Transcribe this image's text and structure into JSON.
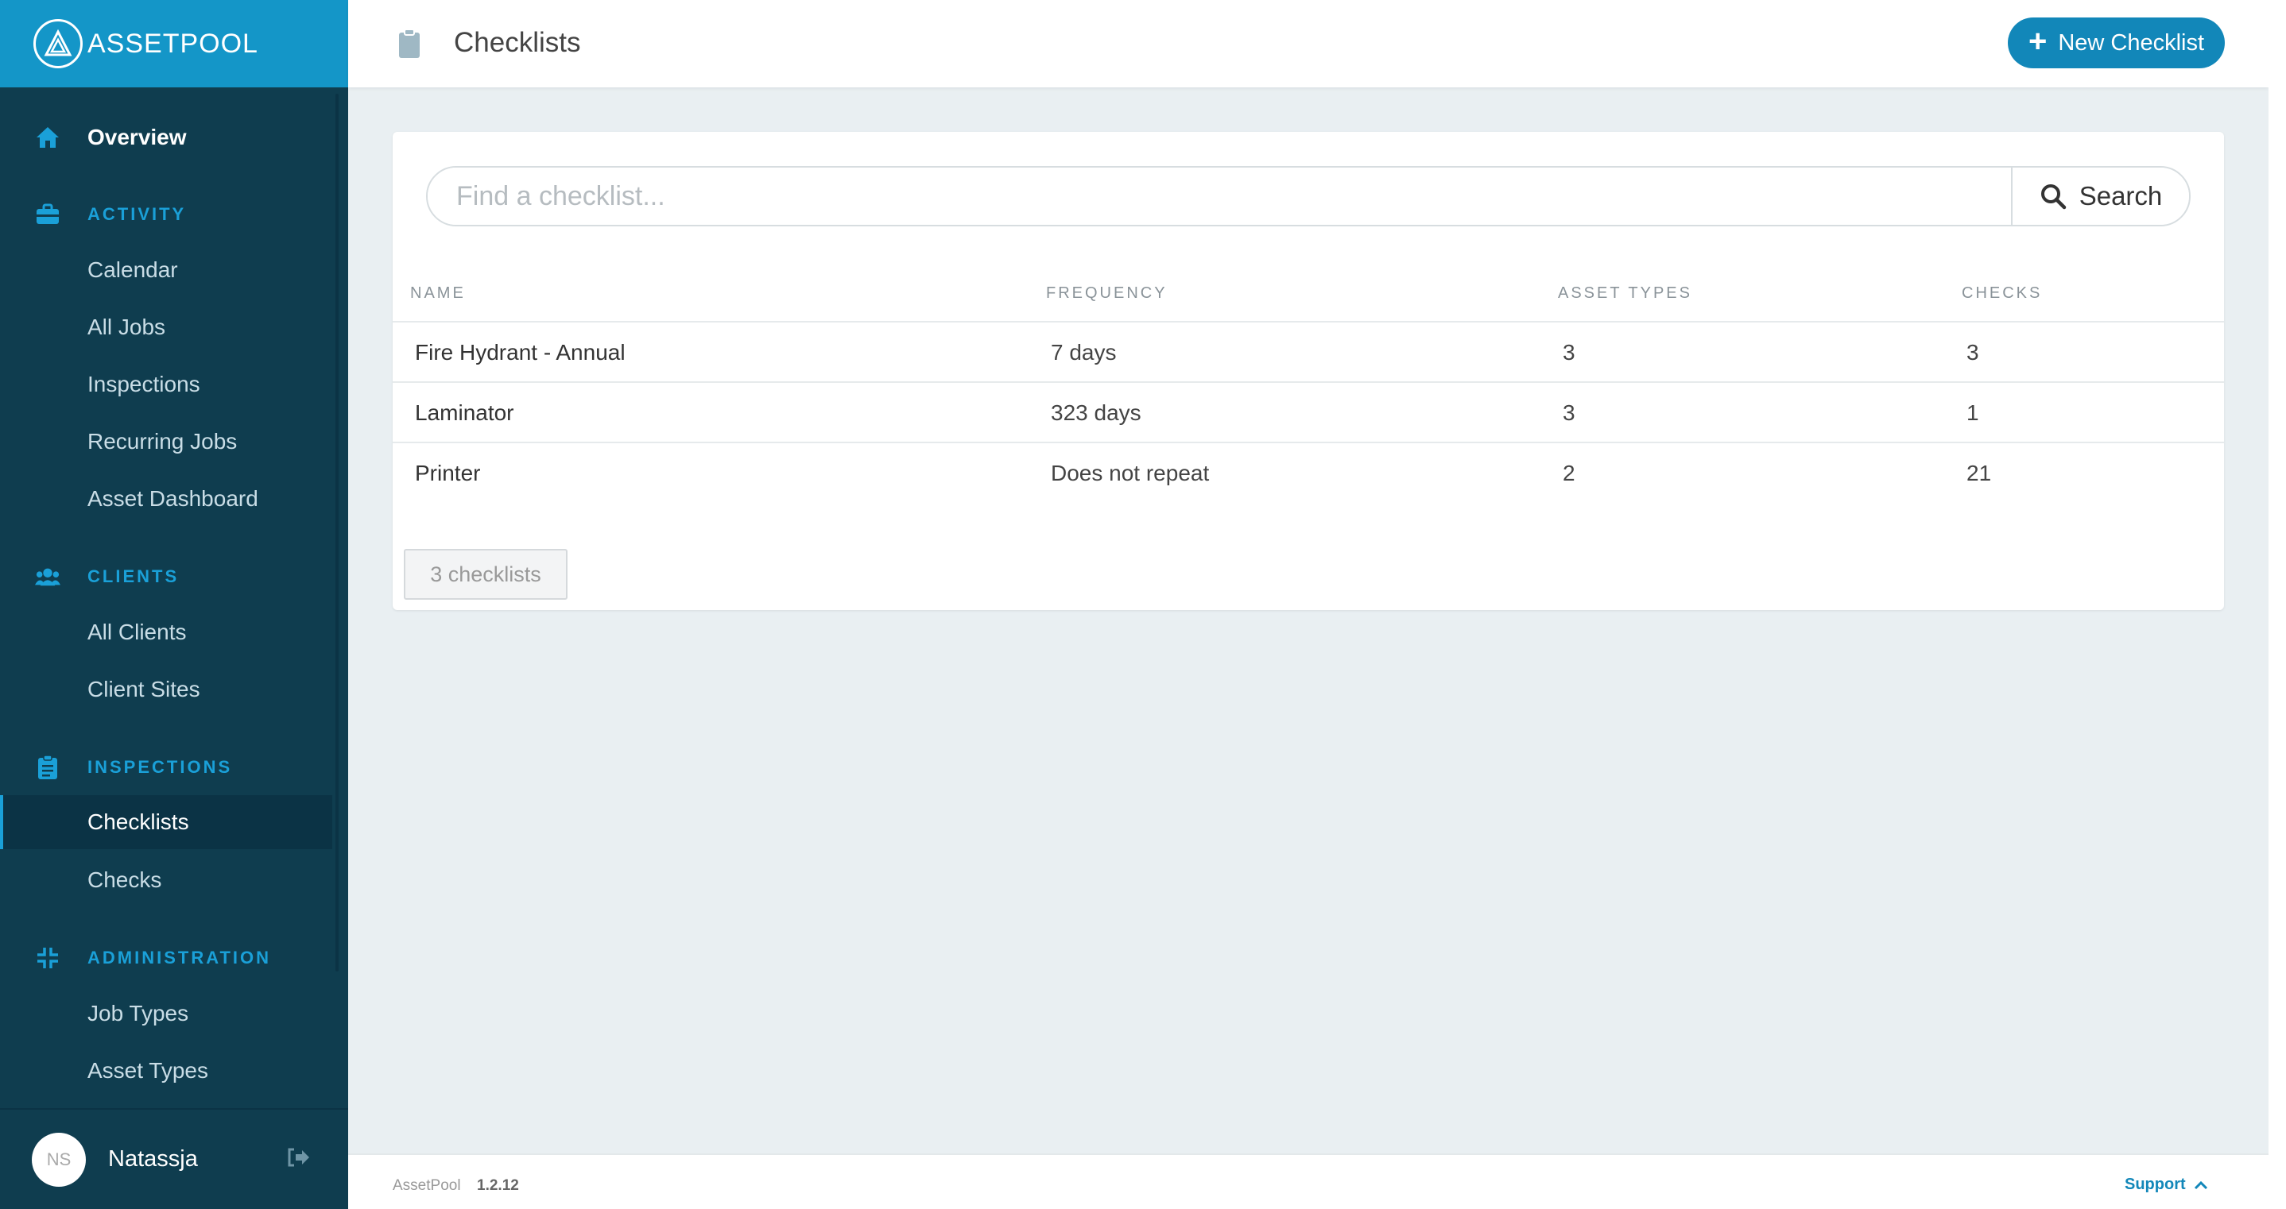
{
  "brand": {
    "name": "ASSETPOOL"
  },
  "sidebar": {
    "overview": "Overview",
    "sections": {
      "activity": {
        "title": "ACTIVITY",
        "items": [
          "Calendar",
          "All Jobs",
          "Inspections",
          "Recurring Jobs",
          "Asset Dashboard"
        ]
      },
      "clients": {
        "title": "CLIENTS",
        "items": [
          "All Clients",
          "Client Sites"
        ]
      },
      "inspections": {
        "title": "INSPECTIONS",
        "items": [
          "Checklists",
          "Checks"
        ],
        "active": "Checklists"
      },
      "administration": {
        "title": "ADMINISTRATION",
        "items": [
          "Job Types",
          "Asset Types"
        ]
      }
    },
    "user": {
      "initials": "NS",
      "name": "Natassja"
    }
  },
  "header": {
    "title": "Checklists",
    "new_button": "New Checklist"
  },
  "search": {
    "placeholder": "Find a checklist...",
    "button": "Search"
  },
  "table": {
    "columns": [
      "NAME",
      "FREQUENCY",
      "ASSET TYPES",
      "CHECKS"
    ],
    "rows": [
      {
        "name": "Fire Hydrant - Annual",
        "frequency": "7 days",
        "asset_types": "3",
        "checks": "3"
      },
      {
        "name": "Laminator",
        "frequency": "323 days",
        "asset_types": "3",
        "checks": "1"
      },
      {
        "name": "Printer",
        "frequency": "Does not repeat",
        "asset_types": "2",
        "checks": "21"
      }
    ]
  },
  "count_label": "3 checklists",
  "footer": {
    "app": "AssetPool",
    "version": "1.2.12",
    "support": "Support"
  },
  "colors": {
    "accent": "#1287b9",
    "sidebar": "#0f3d4f",
    "brand_bar": "#1496c8"
  }
}
